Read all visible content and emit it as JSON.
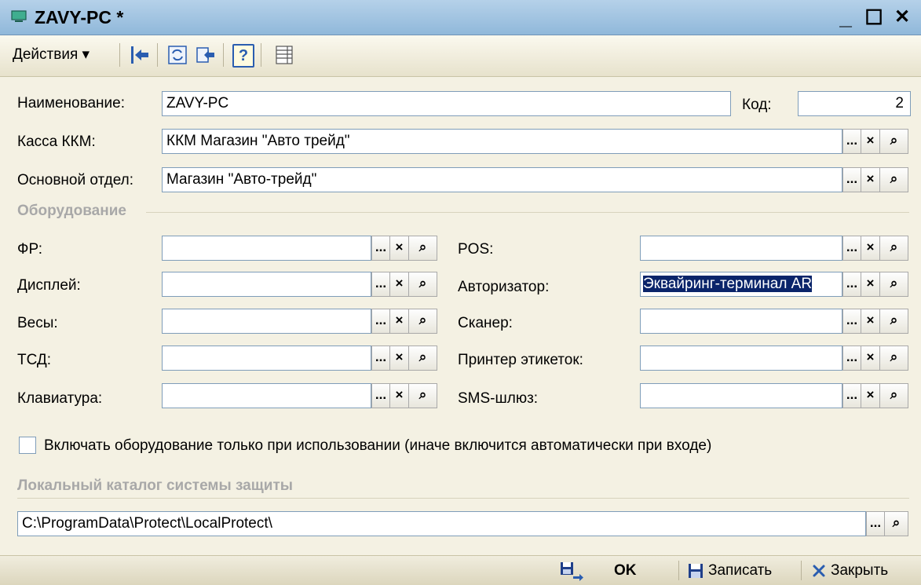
{
  "window": {
    "title": "ZAVY-PC *",
    "title_bg": "#90b8da"
  },
  "toolbar": {
    "actions_label": "Действия ▾",
    "help_label": "?"
  },
  "form": {
    "name_label": "Наименование:",
    "name_value": "ZAVY-PC",
    "code_label": "Код:",
    "code_value": "2",
    "kkm_label": "Касса ККМ:",
    "kkm_value": "ККМ Магазин \"Авто трейд\"",
    "dept_label": "Основной отдел:",
    "dept_value": "Магазин \"Авто-трейд\""
  },
  "equipment": {
    "group_label": "Оборудование",
    "left": [
      {
        "label": "ФР:",
        "value": ""
      },
      {
        "label": "Дисплей:",
        "value": ""
      },
      {
        "label": "Весы:",
        "value": ""
      },
      {
        "label": "ТСД:",
        "value": ""
      },
      {
        "label": "Клавиатура:",
        "value": ""
      }
    ],
    "right": [
      {
        "label": "POS:",
        "value": ""
      },
      {
        "label": "Авторизатор:",
        "value": "Эквайринг-терминал AR"
      },
      {
        "label": "Сканер:",
        "value": ""
      },
      {
        "label": "Принтер этикеток:",
        "value": ""
      },
      {
        "label": "SMS-шлюз:",
        "value": ""
      }
    ]
  },
  "checkbox": {
    "label": "Включать оборудование только при использовании (иначе включится автоматически при входе)",
    "checked": false
  },
  "protect": {
    "group_label": "Локальный каталог системы защиты",
    "path": "C:\\ProgramData\\Protect\\LocalProtect\\"
  },
  "buttons": {
    "select": "...",
    "clear": "×",
    "search": "⌕"
  },
  "footer": {
    "ok_label": "OK",
    "save_label": "Записать",
    "close_label": "Закрыть",
    "close_icon_color": "#2a5db0"
  },
  "titlebar_buttons": {
    "minimize": "_",
    "maximize": "☐",
    "close": "✕"
  }
}
